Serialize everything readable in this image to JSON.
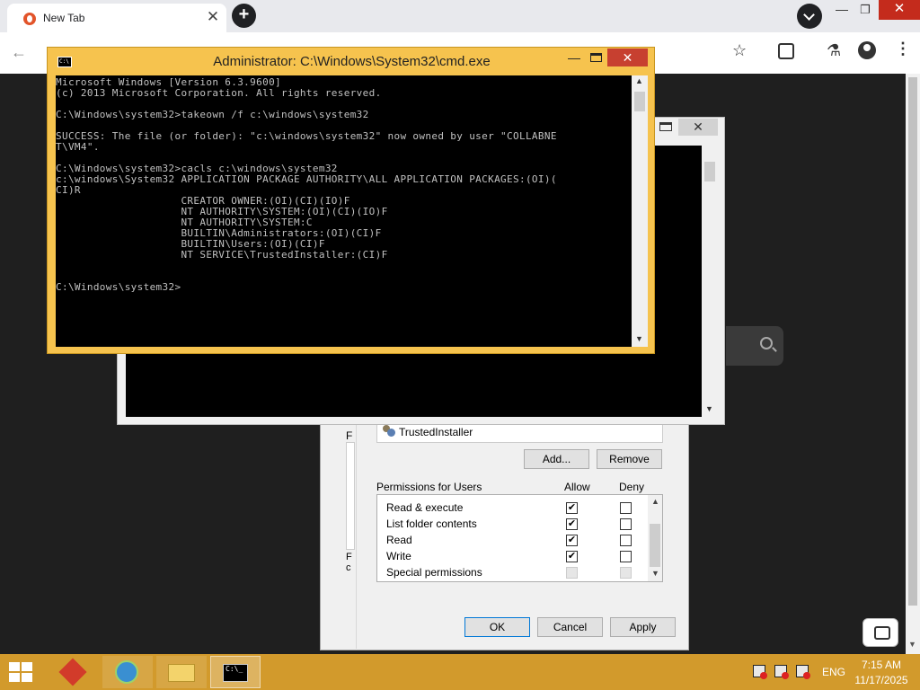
{
  "browser": {
    "tab_title": "New Tab",
    "tab_close": "✕",
    "new_tab": "+",
    "win_min": "—",
    "win_max": "❐",
    "win_close": "✕",
    "back": "←",
    "star": "☆",
    "lab": "⚗",
    "menu": "⋮",
    "scroll_down": "▼"
  },
  "cmd": {
    "title": "Administrator: C:\\Windows\\System32\\cmd.exe",
    "icon_text": "C:\\",
    "min": "—",
    "close": "✕",
    "lines": [
      "Microsoft Windows [Version 6.3.9600]",
      "(c) 2013 Microsoft Corporation. All rights reserved.",
      "",
      "C:\\Windows\\system32>takeown /f c:\\windows\\system32",
      "",
      "SUCCESS: The file (or folder): \"c:\\windows\\system32\" now owned by user \"COLLABNE",
      "T\\VM4\".",
      "",
      "C:\\Windows\\system32>cacls c:\\windows\\system32",
      "c:\\windows\\System32 APPLICATION PACKAGE AUTHORITY\\ALL APPLICATION PACKAGES:(OI)(",
      "CI)R",
      "                    CREATOR OWNER:(OI)(CI)(IO)F",
      "                    NT AUTHORITY\\SYSTEM:(OI)(CI)(IO)F",
      "                    NT AUTHORITY\\SYSTEM:C",
      "                    BUILTIN\\Administrators:(OI)(CI)F",
      "                    BUILTIN\\Users:(OI)(CI)F",
      "                    NT SERVICE\\TrustedInstaller:(CI)F",
      "",
      "",
      "C:\\Windows\\system32>"
    ]
  },
  "console2": {
    "close": "✕"
  },
  "properties": {
    "side_label": "F",
    "side_label2": "F\nc",
    "user": "TrustedInstaller",
    "add_button": "Add...",
    "remove_button": "Remove",
    "perm_header": "Permissions for Users",
    "allow_header": "Allow",
    "deny_header": "Deny",
    "permissions": [
      {
        "name": "Read & execute",
        "allow": true,
        "deny": false
      },
      {
        "name": "List folder contents",
        "allow": true,
        "deny": false
      },
      {
        "name": "Read",
        "allow": true,
        "deny": false
      },
      {
        "name": "Write",
        "allow": true,
        "deny": false
      },
      {
        "name": "Special permissions",
        "allow": false,
        "deny": false,
        "disabled": true
      }
    ],
    "ok": "OK",
    "cancel": "Cancel",
    "apply": "Apply"
  },
  "taskbar": {
    "console_icon_text": "C:\\_",
    "language": "ENG",
    "time": "7:15 AM",
    "date": "11/17/2025"
  }
}
